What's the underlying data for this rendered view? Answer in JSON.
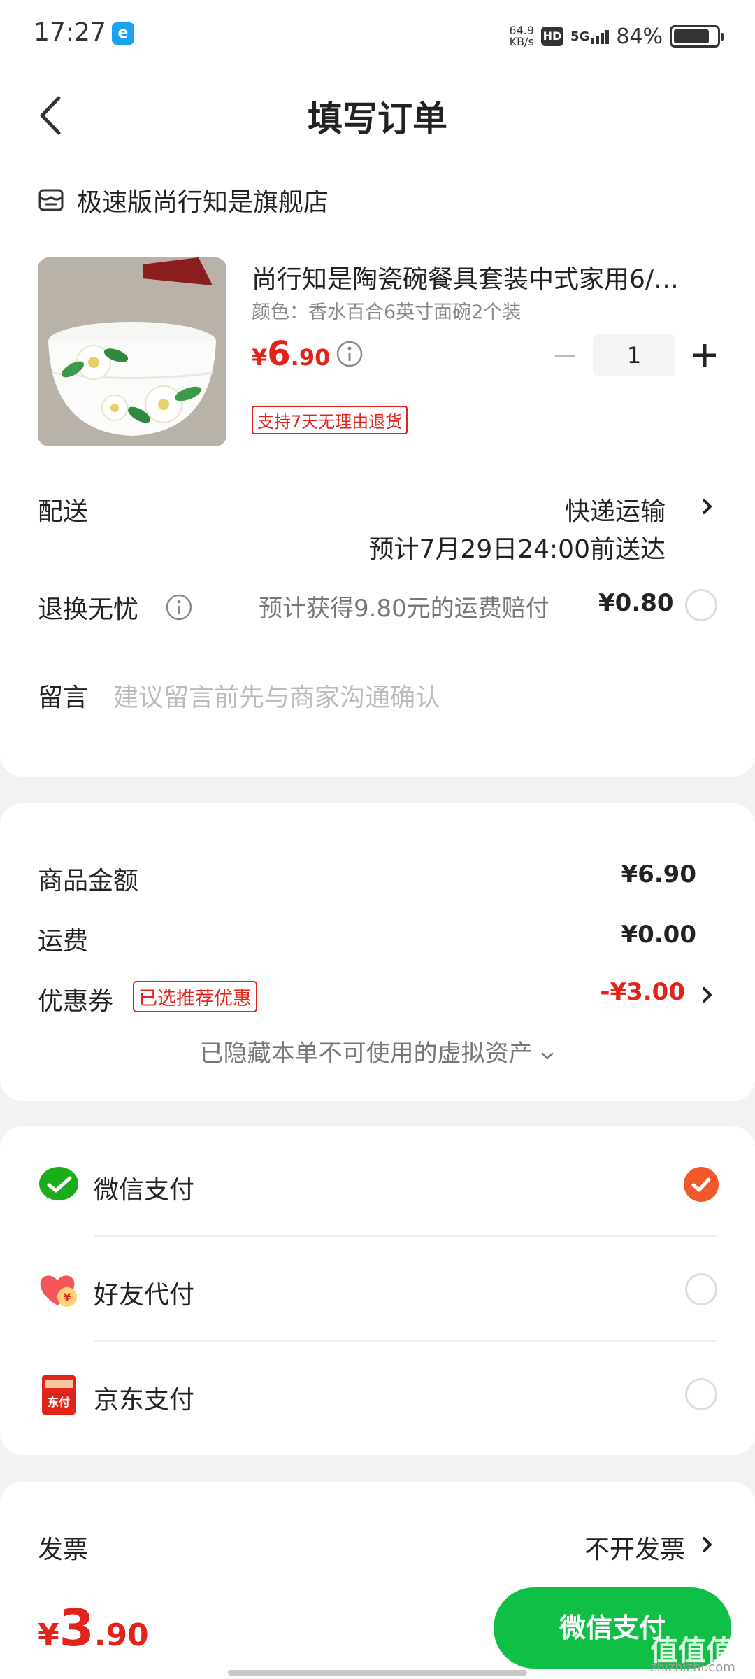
{
  "status_bar": {
    "time": "17:27",
    "net_speed_value": "64.9",
    "net_speed_unit": "KB/s",
    "hd": "HD",
    "signal": "5G",
    "battery": "84%",
    "battery_level": 0.84
  },
  "nav": {
    "title": "填写订单"
  },
  "shop": {
    "name": "极速版尚行知是旗舰店"
  },
  "product": {
    "title": "尚行知是陶瓷碗餐具套装中式家用6/…",
    "spec": "颜色：香水百合6英寸面碗2个装",
    "price_symbol": "¥",
    "price_int": "6",
    "price_dec": ".90",
    "quantity": "1",
    "return_tag": "支持7天无理由退货"
  },
  "delivery": {
    "label": "配送",
    "method": "快递运输",
    "eta": "预计7月29日24:00前送达"
  },
  "worry_free": {
    "label": "退换无忧",
    "desc": "预计获得9.80元的运费赔付",
    "price": "¥0.80"
  },
  "message": {
    "label": "留言",
    "placeholder": "建议留言前先与商家沟通确认"
  },
  "summary": {
    "goods_label": "商品金额",
    "goods_value": "¥6.90",
    "shipping_label": "运费",
    "shipping_value": "¥0.00",
    "coupon_label": "优惠券",
    "coupon_tag": "已选推荐优惠",
    "coupon_value": "-¥3.00",
    "hidden_assets": "已隐藏本单不可使用的虚拟资产"
  },
  "payment": {
    "options": [
      {
        "label": "微信支付",
        "selected": true
      },
      {
        "label": "好友代付",
        "selected": false
      },
      {
        "label": "京东支付",
        "selected": false
      }
    ],
    "friend_badge": "¥",
    "jd_badge": "东付"
  },
  "invoice": {
    "label": "发票",
    "value": "不开发票"
  },
  "bottom": {
    "total_symbol": "¥",
    "total_int": "3",
    "total_dec": ".90",
    "pay_button": "微信支付",
    "watermark": "值值值",
    "watermark_url": "zhizhizhi.com"
  },
  "colors": {
    "accent_red": "#e2231a",
    "wechat_green": "#10c046",
    "check_orange": "#f05a2b"
  }
}
